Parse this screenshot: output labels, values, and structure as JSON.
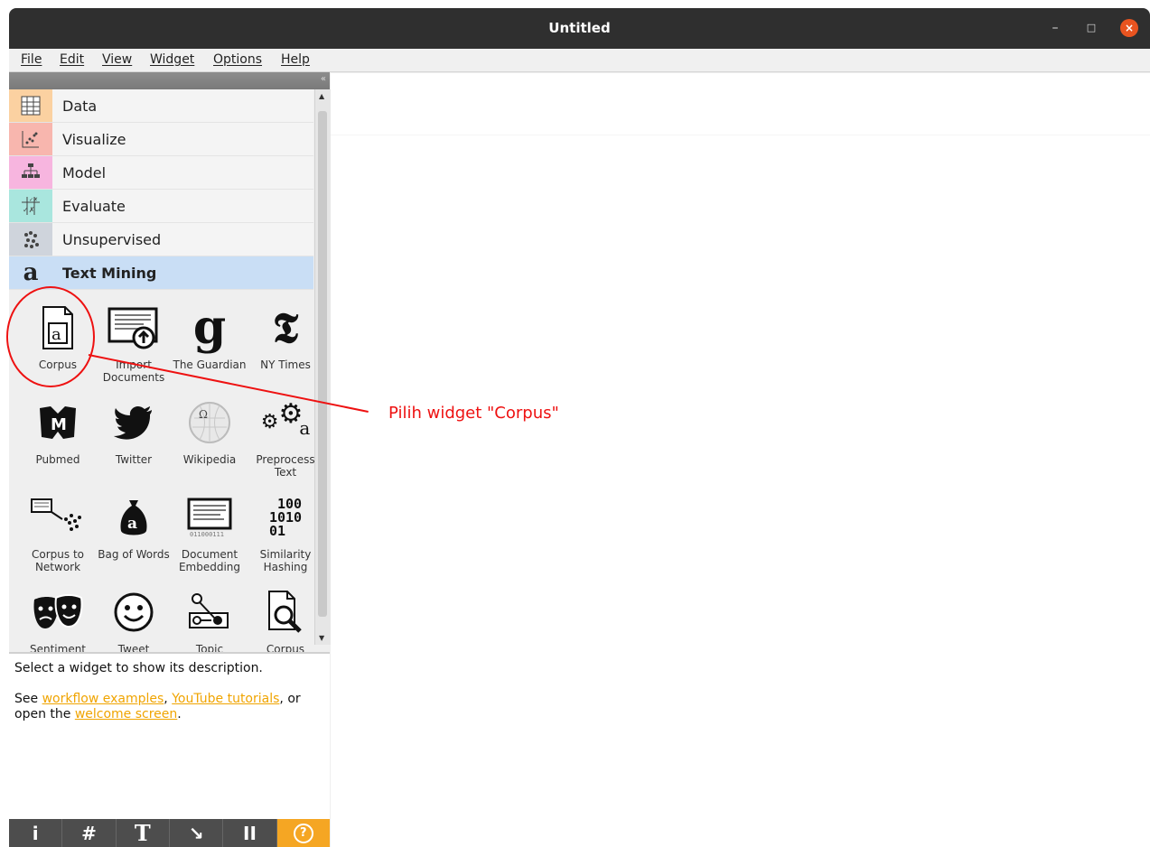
{
  "window": {
    "title": "Untitled"
  },
  "menu": [
    "File",
    "Edit",
    "View",
    "Widget",
    "Options",
    "Help"
  ],
  "categories": [
    {
      "label": "Data",
      "icon": "table-grid-icon",
      "color": "#fbd1a1"
    },
    {
      "label": "Visualize",
      "icon": "scatter-plot-icon",
      "color": "#f8b6ae"
    },
    {
      "label": "Model",
      "icon": "tree-icon",
      "color": "#f7b5df"
    },
    {
      "label": "Evaluate",
      "icon": "evaluate-icon",
      "color": "#a9e6de"
    },
    {
      "label": "Unsupervised",
      "icon": "clusters-icon",
      "color": "#cfd4dc"
    },
    {
      "label": "Text Mining",
      "icon": "text-mining-icon",
      "color": "#c9def5"
    }
  ],
  "widgets": [
    {
      "label": "Corpus",
      "icon": "corpus-document-icon"
    },
    {
      "label": "Import Documents",
      "icon": "import-documents-icon"
    },
    {
      "label": "The Guardian",
      "icon": "guardian-logo-icon"
    },
    {
      "label": "NY Times",
      "icon": "nytimes-logo-icon"
    },
    {
      "label": "Pubmed",
      "icon": "pubmed-logo-icon"
    },
    {
      "label": "Twitter",
      "icon": "twitter-bird-icon"
    },
    {
      "label": "Wikipedia",
      "icon": "wikipedia-globe-icon"
    },
    {
      "label": "Preprocess Text",
      "icon": "preprocess-gears-icon"
    },
    {
      "label": "Corpus to Network",
      "icon": "corpus-network-icon"
    },
    {
      "label": "Bag of Words",
      "icon": "bag-of-words-icon"
    },
    {
      "label": "Document Embedding",
      "icon": "document-embedding-icon"
    },
    {
      "label": "Similarity Hashing",
      "icon": "binary-hash-icon"
    },
    {
      "label": "Sentiment",
      "icon": "theatre-masks-icon"
    },
    {
      "label": "Tweet",
      "icon": "smiley-face-icon"
    },
    {
      "label": "Topic",
      "icon": "topic-graph-icon"
    },
    {
      "label": "Corpus",
      "icon": "corpus-search-icon"
    }
  ],
  "description": {
    "line1": "Select a widget to show its description.",
    "see": "See ",
    "link1": "workflow examples",
    "sep1": ", ",
    "link2": "YouTube tutorials",
    "sep2": ", or open the ",
    "link3": "welcome screen",
    "end": "."
  },
  "toolbar": [
    "i",
    "#",
    "T",
    "↘",
    "II",
    "?"
  ],
  "annotation": {
    "text": "Pilih widget \"Corpus\""
  },
  "colors": {
    "annotation": "#ee1111",
    "link": "#f0a400",
    "help_button": "#f5a623",
    "titlebar": "#2f2f2f"
  }
}
